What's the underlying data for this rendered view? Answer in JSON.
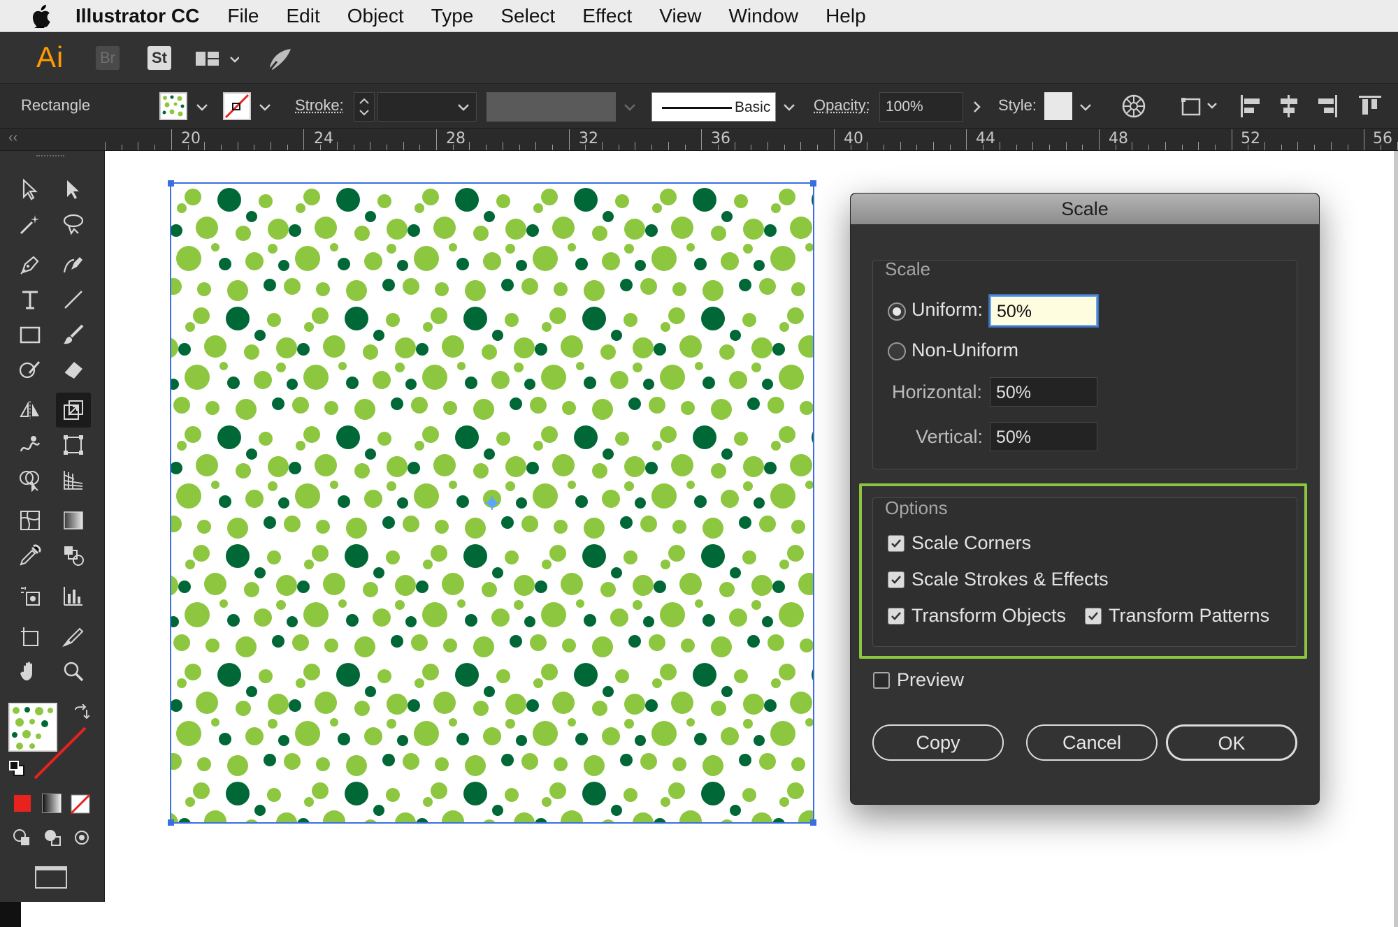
{
  "menubar": {
    "app_name": "Illustrator CC",
    "items": [
      "File",
      "Edit",
      "Object",
      "Type",
      "Select",
      "Effect",
      "View",
      "Window",
      "Help"
    ]
  },
  "appbar": {
    "logo": "Ai",
    "bridge": "Br",
    "stock": "St"
  },
  "controlbar": {
    "object_type": "Rectangle",
    "stroke_label": "Stroke:",
    "stroke_style": "Basic",
    "opacity_label": "Opacity:",
    "opacity_value": "100%",
    "style_label": "Style:"
  },
  "ruler": {
    "labels": [
      "20",
      "24",
      "28",
      "32",
      "36",
      "40",
      "44",
      "48",
      "52",
      "56"
    ]
  },
  "colors": {
    "dot_light": "#8dc63f",
    "dot_dark": "#006837",
    "selection": "#3b6fe0",
    "highlight": "#8cc63f",
    "fill_red": "#e8231d"
  },
  "dialog": {
    "title": "Scale",
    "scale_group": "Scale",
    "uniform_label": "Uniform:",
    "uniform_value": "50%",
    "nonuniform_label": "Non-Uniform",
    "horizontal_label": "Horizontal:",
    "horizontal_value": "50%",
    "vertical_label": "Vertical:",
    "vertical_value": "50%",
    "options_group": "Options",
    "scale_corners": "Scale Corners",
    "scale_strokes": "Scale Strokes & Effects",
    "transform_objects": "Transform Objects",
    "transform_patterns": "Transform Patterns",
    "preview": "Preview",
    "copy_button": "Copy",
    "cancel_button": "Cancel",
    "ok_button": "OK"
  }
}
